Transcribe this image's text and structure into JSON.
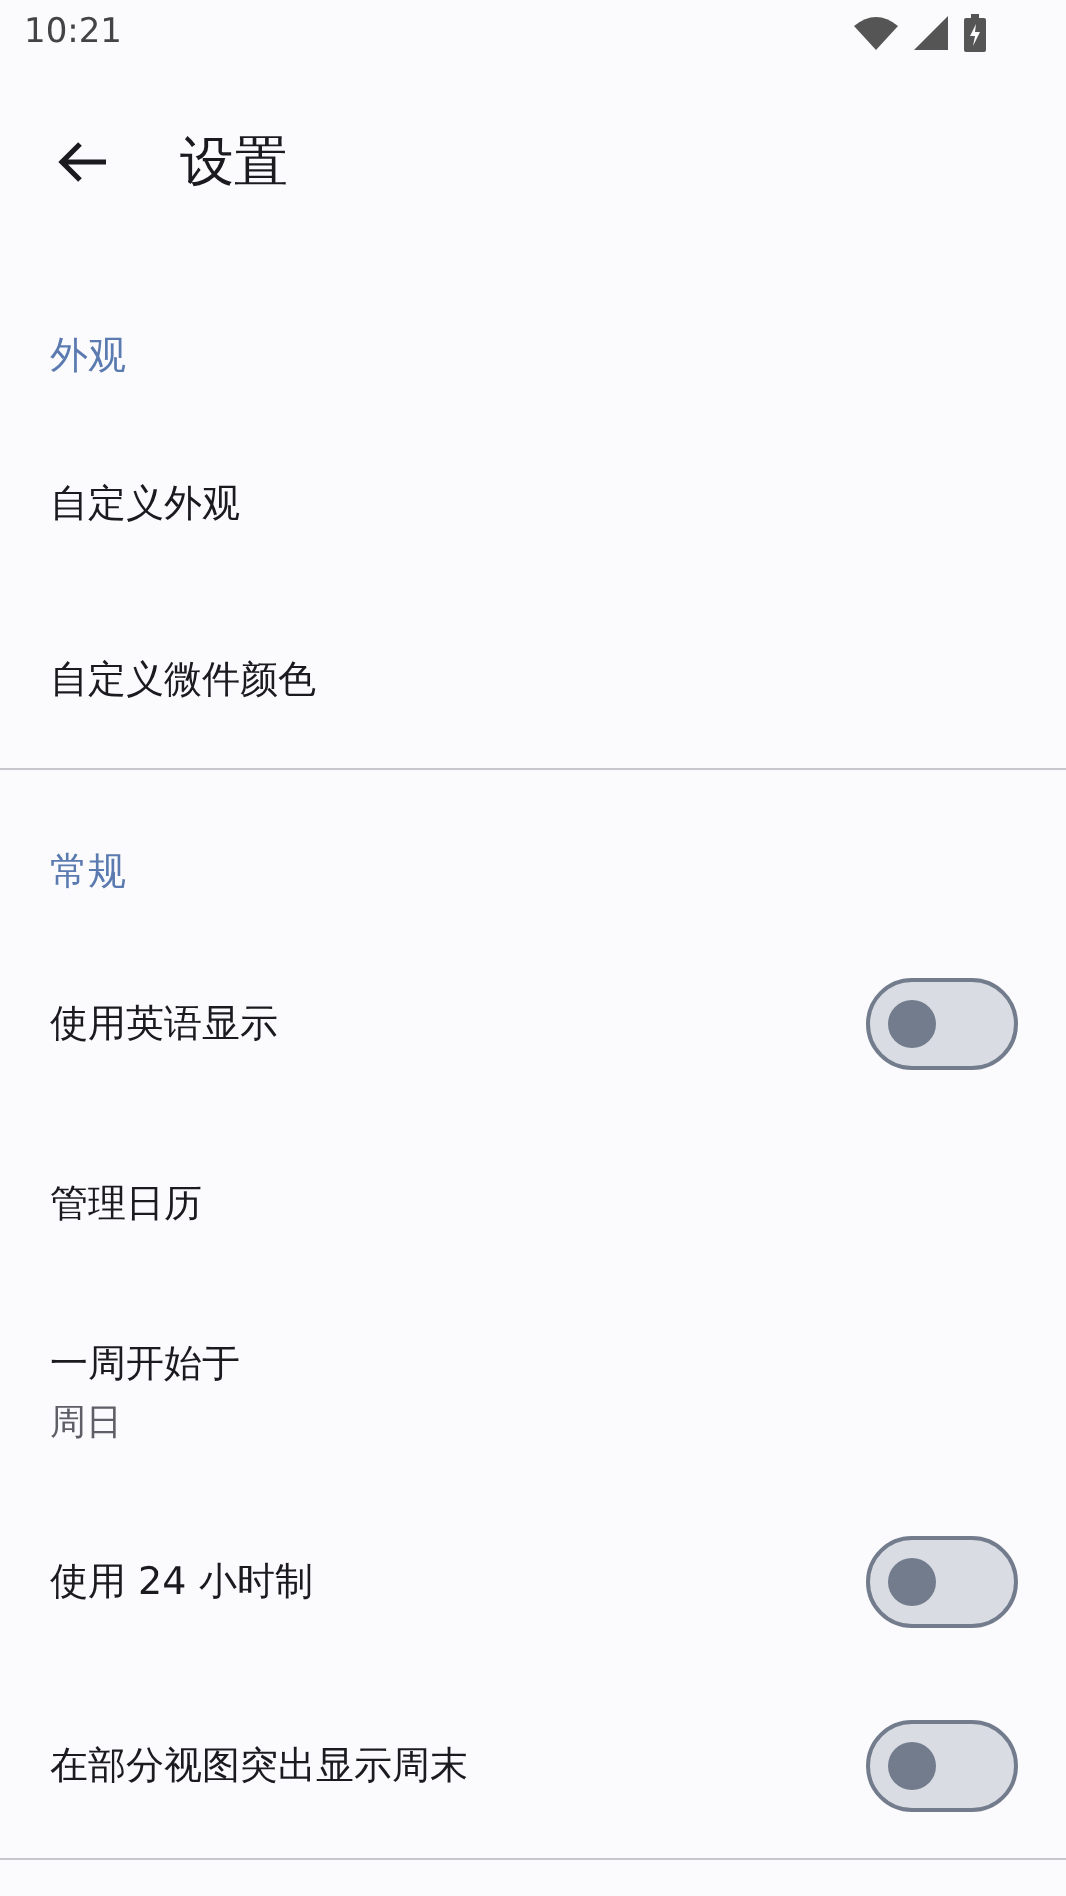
{
  "status_bar": {
    "time": "10:21"
  },
  "toolbar": {
    "title": "设置"
  },
  "sections": [
    {
      "title": "外观",
      "items": [
        {
          "kind": "link",
          "label": "自定义外观"
        },
        {
          "kind": "link",
          "label": "自定义微件颜色"
        }
      ]
    },
    {
      "title": "常规",
      "items": [
        {
          "kind": "toggle",
          "label": "使用英语显示",
          "on": false
        },
        {
          "kind": "link",
          "label": "管理日历"
        },
        {
          "kind": "value",
          "label": "一周开始于",
          "summary": "周日"
        },
        {
          "kind": "toggle",
          "label": "使用 24 小时制",
          "on": false
        },
        {
          "kind": "toggle",
          "label": "在部分视图突出显示周末",
          "on": false
        }
      ]
    }
  ]
}
